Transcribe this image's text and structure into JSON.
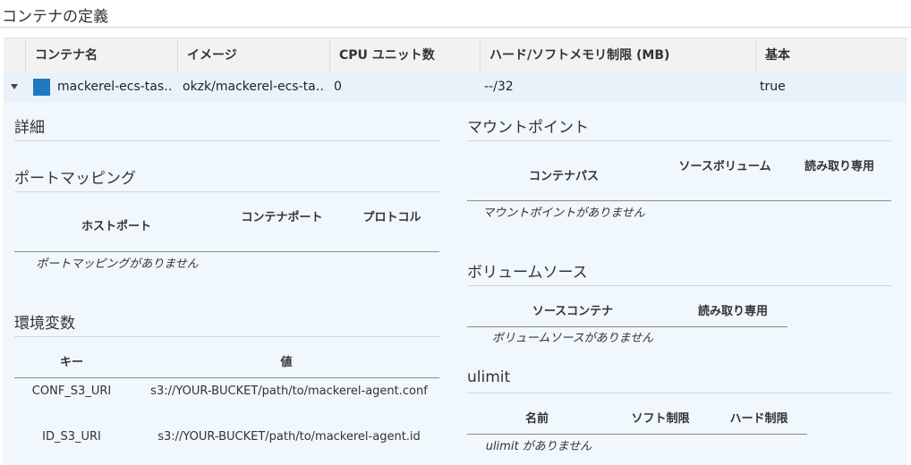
{
  "page": {
    "title": "コンテナの定義"
  },
  "container_table": {
    "columns": [
      "コンテナ名",
      "イメージ",
      "CPU ユニット数",
      "ハード/ソフトメモリ制限 (MB)",
      "基本"
    ],
    "row": {
      "name": "mackerel-ecs-tas…",
      "image": "okzk/mackerel-ecs-ta…",
      "cpu": "0",
      "memory": "--/32",
      "essential": "true",
      "swatch_color": "#1f78c1"
    }
  },
  "details": {
    "title": "詳細",
    "port_mappings": {
      "title": "ポートマッピング",
      "columns": [
        "ホストポート",
        "コンテナポート",
        "プロトコル"
      ],
      "empty": "ポートマッピングがありません"
    },
    "env": {
      "title": "環境変数",
      "columns": [
        "キー",
        "値"
      ],
      "rows": [
        {
          "key": "CONF_S3_URI",
          "value": "s3://YOUR-BUCKET/path/to/mackerel-agent.conf"
        },
        {
          "key": "ID_S3_URI",
          "value": "s3://YOUR-BUCKET/path/to/mackerel-agent.id"
        }
      ]
    },
    "mount_points": {
      "title": "マウントポイント",
      "columns": [
        "コンテナパス",
        "ソースボリューム",
        "読み取り専用"
      ],
      "empty": "マウントポイントがありません"
    },
    "volume_sources": {
      "title": "ボリュームソース",
      "columns": [
        "ソースコンテナ",
        "読み取り専用"
      ],
      "empty": "ボリュームソースがありません"
    },
    "ulimit": {
      "title": "ulimit",
      "columns": [
        "名前",
        "ソフト制限",
        "ハード制限"
      ],
      "empty": "ulimit がありません"
    }
  }
}
